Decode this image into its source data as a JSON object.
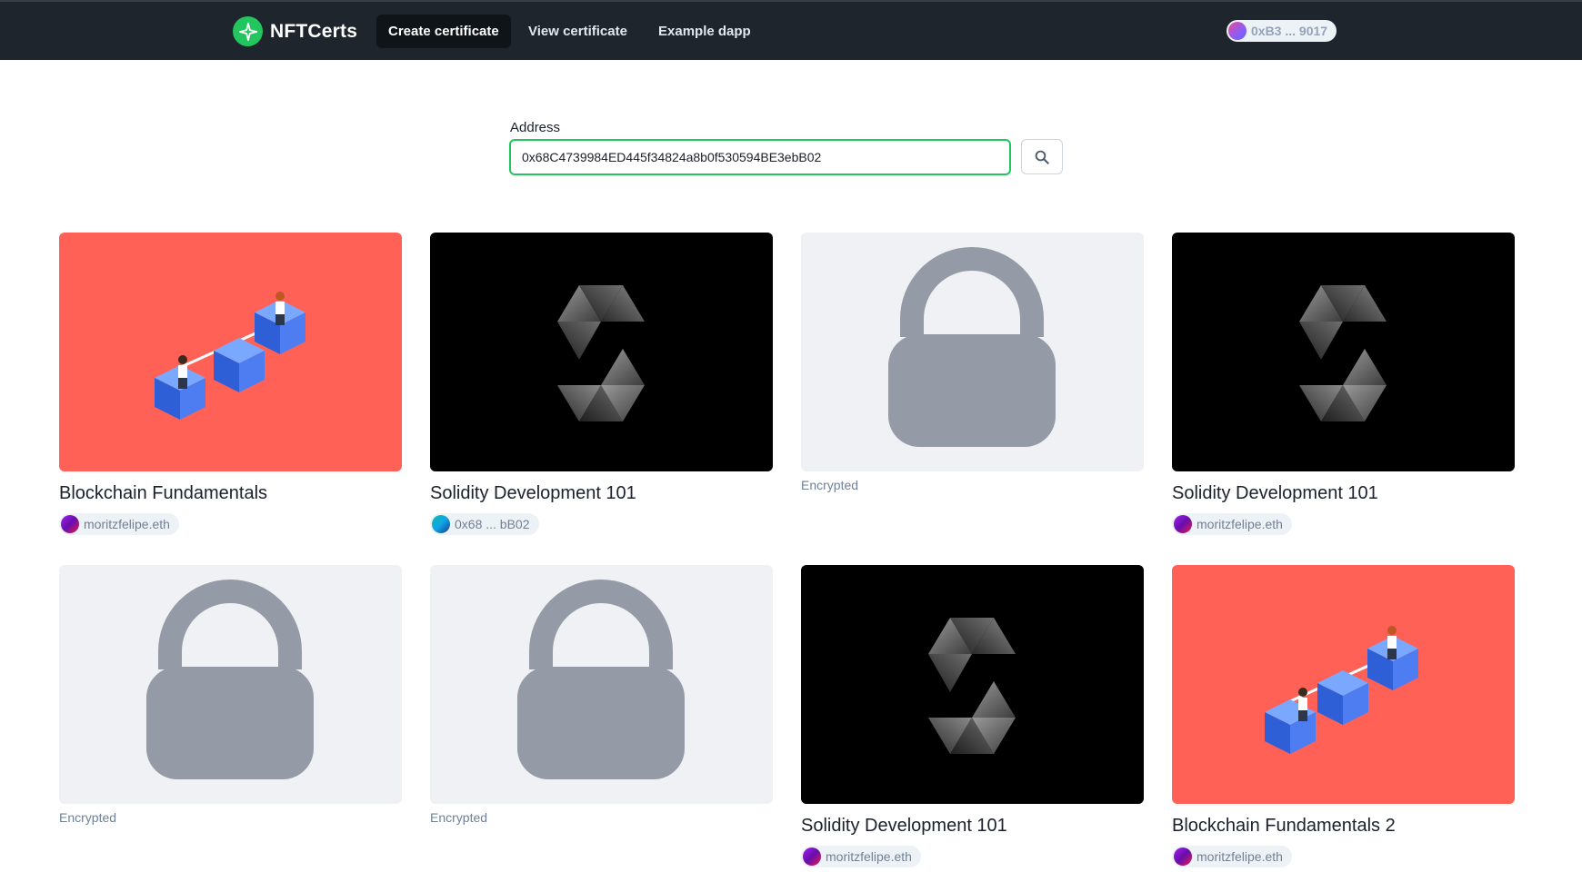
{
  "navbar": {
    "brand": "NFTCerts",
    "items": [
      {
        "label": "Create certificate",
        "active": true
      },
      {
        "label": "View certificate",
        "active": false
      },
      {
        "label": "Example dapp",
        "active": false
      }
    ],
    "wallet": "0xB3 ... 9017"
  },
  "search": {
    "label": "Address",
    "value": "0x68C4739984ED445f34824a8b0f530594BE3ebB02",
    "icon": "search-icon"
  },
  "cards": [
    {
      "media": "blockchain-illustration",
      "title": "Blockchain Fundamentals",
      "owner": "moritzfelipe.eth",
      "avatar": "purple"
    },
    {
      "media": "solidity-logo",
      "title": "Solidity Development 101",
      "owner": "0x68 ... bB02",
      "avatar": "teal"
    },
    {
      "media": "lock-icon",
      "status": "Encrypted"
    },
    {
      "media": "solidity-logo",
      "title": "Solidity Development 101",
      "owner": "moritzfelipe.eth",
      "avatar": "purple"
    },
    {
      "media": "lock-icon",
      "status": "Encrypted"
    },
    {
      "media": "lock-icon",
      "status": "Encrypted"
    },
    {
      "media": "solidity-logo",
      "title": "Solidity Development 101",
      "owner": "moritzfelipe.eth",
      "avatar": "purple"
    },
    {
      "media": "blockchain-illustration",
      "title": "Blockchain Fundamentals 2",
      "owner": "moritzfelipe.eth",
      "avatar": "purple"
    }
  ],
  "colors": {
    "navbar": "#1f252d",
    "accent": "#22c55e",
    "coral": "#ff6157",
    "lock": "#949ba6"
  }
}
